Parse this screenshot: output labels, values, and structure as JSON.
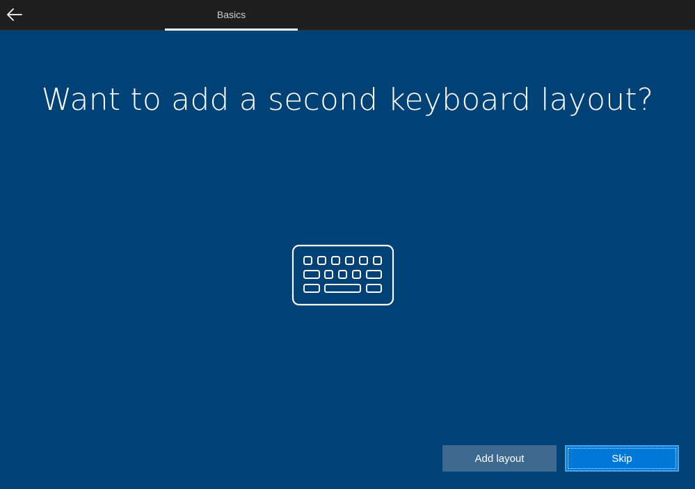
{
  "header": {
    "back_icon": "arrow-left-icon",
    "tab_label": "Basics"
  },
  "main": {
    "title": "Want to add a second keyboard layout?",
    "illustration_icon": "keyboard-icon"
  },
  "actions": {
    "add_label": "Add layout",
    "skip_label": "Skip"
  },
  "colors": {
    "background": "#004275",
    "topbar": "#1f1f1f",
    "secondary_button": "#3d6991",
    "primary_button": "#0078d7"
  }
}
